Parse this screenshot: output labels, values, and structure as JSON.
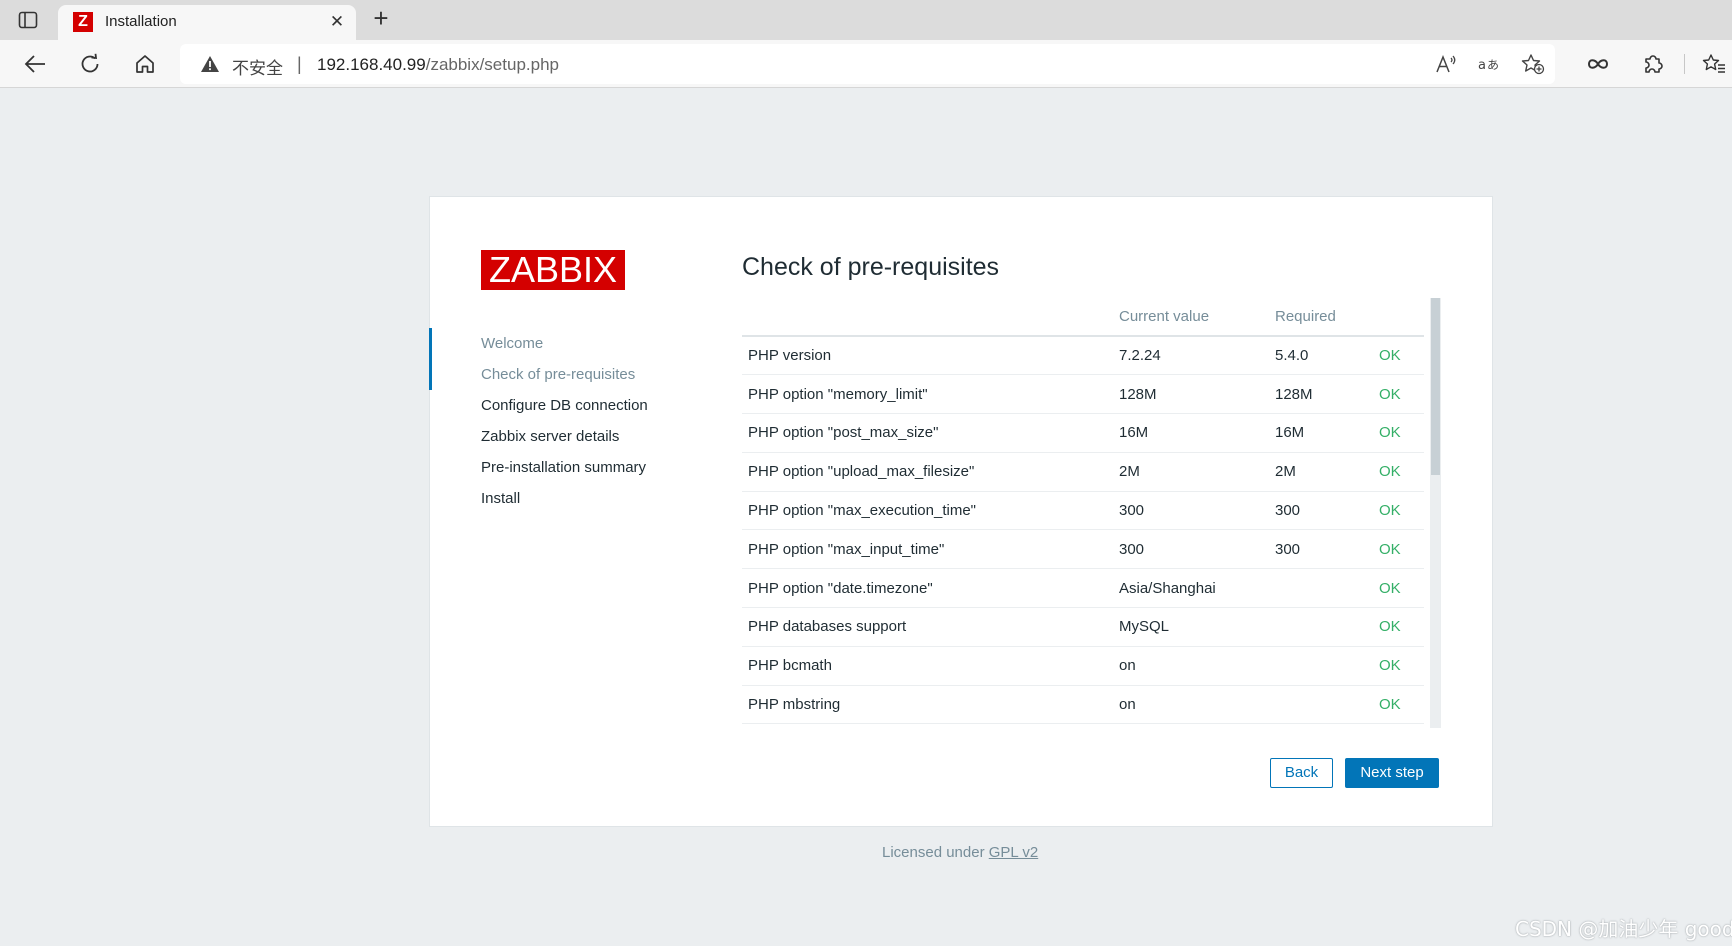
{
  "browser": {
    "tab_title": "Installation",
    "tab_favicon_letter": "Z",
    "insecure_label": "不安全",
    "address_separator": "|",
    "url_host": "192.168.40.99",
    "url_path": "/zabbix/setup.php"
  },
  "icons": {
    "tab_actions": "tab-actions-icon",
    "close": "close-icon",
    "new_tab": "plus-icon",
    "back": "arrow-left-icon",
    "reload": "reload-icon",
    "home": "home-icon",
    "warning": "warning-icon",
    "read_aloud": "read-aloud-icon",
    "translate": "translate-icon",
    "add_favorite": "star-add-icon",
    "infinity": "infinity-icon",
    "extensions": "puzzle-icon",
    "favorites": "favorites-icon"
  },
  "colors": {
    "brand_red": "#d40000",
    "accent_blue": "#0275b8",
    "ok_green": "#34af67",
    "muted_text": "#768d99"
  },
  "logo": {
    "text": "ZABBIX"
  },
  "steps": [
    {
      "label": "Welcome",
      "state": "done"
    },
    {
      "label": "Check of pre-requisites",
      "state": "current"
    },
    {
      "label": "Configure DB connection",
      "state": "pending"
    },
    {
      "label": "Zabbix server details",
      "state": "pending"
    },
    {
      "label": "Pre-installation summary",
      "state": "pending"
    },
    {
      "label": "Install",
      "state": "pending"
    }
  ],
  "main": {
    "title": "Check of pre-requisites",
    "table": {
      "headers": {
        "name": "",
        "current": "Current value",
        "required": "Required",
        "status": ""
      },
      "rows": [
        {
          "name": "PHP version",
          "current": "7.2.24",
          "required": "5.4.0",
          "status": "OK"
        },
        {
          "name": "PHP option \"memory_limit\"",
          "current": "128M",
          "required": "128M",
          "status": "OK"
        },
        {
          "name": "PHP option \"post_max_size\"",
          "current": "16M",
          "required": "16M",
          "status": "OK"
        },
        {
          "name": "PHP option \"upload_max_filesize\"",
          "current": "2M",
          "required": "2M",
          "status": "OK"
        },
        {
          "name": "PHP option \"max_execution_time\"",
          "current": "300",
          "required": "300",
          "status": "OK"
        },
        {
          "name": "PHP option \"max_input_time\"",
          "current": "300",
          "required": "300",
          "status": "OK"
        },
        {
          "name": "PHP option \"date.timezone\"",
          "current": "Asia/Shanghai",
          "required": "",
          "status": "OK"
        },
        {
          "name": "PHP databases support",
          "current": "MySQL",
          "required": "",
          "status": "OK"
        },
        {
          "name": "PHP bcmath",
          "current": "on",
          "required": "",
          "status": "OK"
        },
        {
          "name": "PHP mbstring",
          "current": "on",
          "required": "",
          "status": "OK"
        }
      ]
    },
    "buttons": {
      "back": "Back",
      "next": "Next step"
    }
  },
  "footer": {
    "prefix": "Licensed under ",
    "link": "GPL v2"
  },
  "watermark": "CSDN @加油少年 good"
}
